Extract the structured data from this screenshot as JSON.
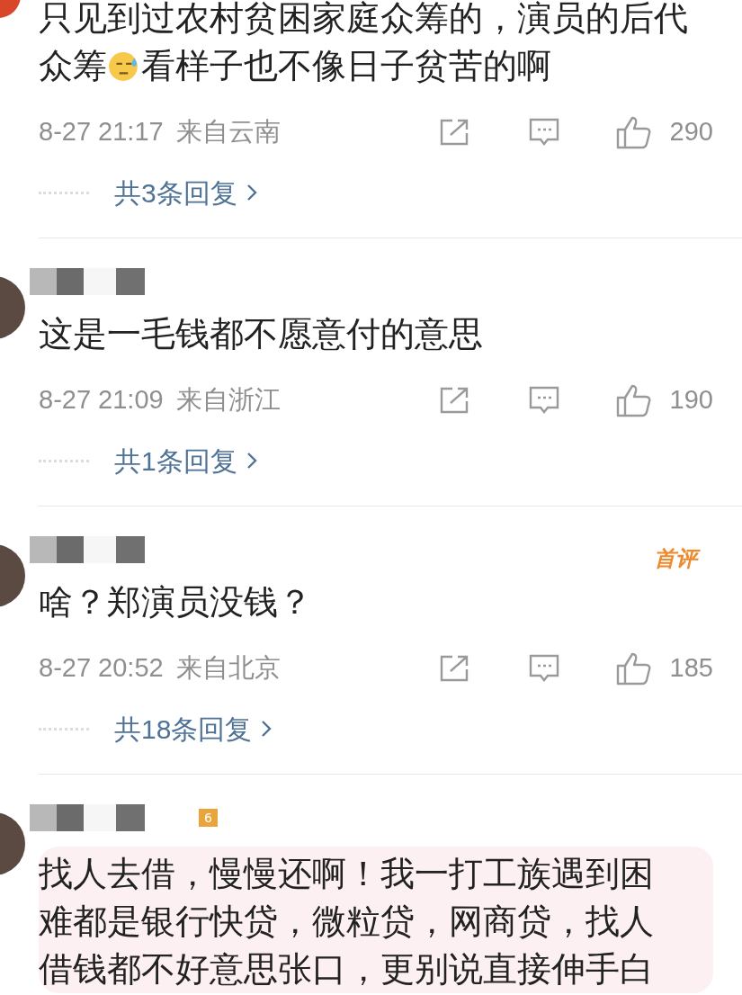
{
  "comments": [
    {
      "segments": [
        {
          "kind": "text",
          "text": "只见到过农村贫困家庭众筹的，演员的后代众筹"
        },
        {
          "kind": "emoji"
        },
        {
          "kind": "text",
          "text": "看样子也不像日子贫苦的啊"
        }
      ],
      "time": "8-27 21:17",
      "location": "来自云南",
      "likes": "290",
      "replies": "共3条回复",
      "highlighted": false
    },
    {
      "blurred_name": true,
      "segments": [
        {
          "kind": "text",
          "text": "这是一毛钱都不愿意付的意思"
        }
      ],
      "time": "8-27 21:09",
      "location": "来自浙江",
      "likes": "190",
      "replies": "共1条回复",
      "highlighted": false
    },
    {
      "blurred_name": true,
      "badge": "首评",
      "segments": [
        {
          "kind": "text",
          "text": "啥？郑演员没钱？"
        }
      ],
      "time": "8-27 20:52",
      "location": "来自北京",
      "likes": "185",
      "replies": "共18条回复",
      "highlighted": false
    },
    {
      "blurred_name": true,
      "level_badge": "6",
      "segments": [
        {
          "kind": "text",
          "text": "找人去借，慢慢还啊！我一打工族遇到困难都是银行快贷，微粒贷，网商贷，找人借钱都不好意思张口，更别说直接伸手白"
        }
      ],
      "highlighted": true
    }
  ]
}
